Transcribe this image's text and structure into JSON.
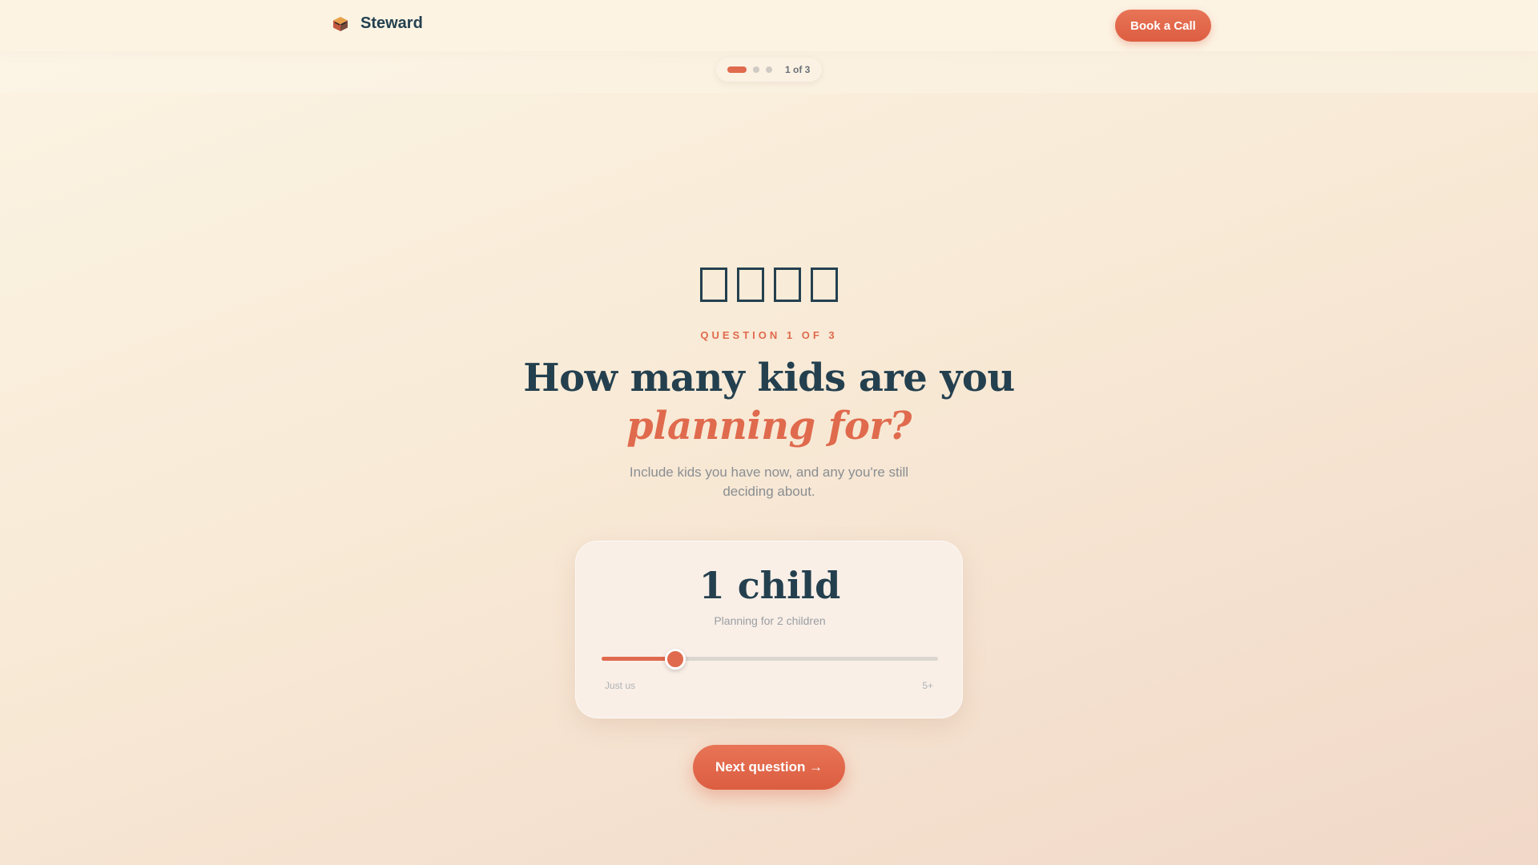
{
  "header": {
    "brand_name": "Steward",
    "brand_icon": "steward-logo-icon",
    "cta_label": "Book a Call"
  },
  "progress": {
    "text": "1 of 3",
    "current_step": 1,
    "total_steps": 3
  },
  "question": {
    "emoji_placeholders": [
      "□",
      "□",
      "□",
      "□"
    ],
    "label": "QUESTION 1 OF 3",
    "headline": "How many kids are you",
    "headline_accent": "planning for?",
    "subtitle": "Include kids you have now, and any you're still deciding about."
  },
  "card": {
    "count_text": "1 child",
    "planning_text": "Planning for 2 children",
    "slider": {
      "value_fraction": 0.22,
      "min_label": "Just us",
      "max_label": "5+"
    }
  },
  "actions": {
    "next_label": "Next question →"
  },
  "colors": {
    "accent": "#e06a4d",
    "ink": "#24404f",
    "background": "#f8ead6"
  }
}
